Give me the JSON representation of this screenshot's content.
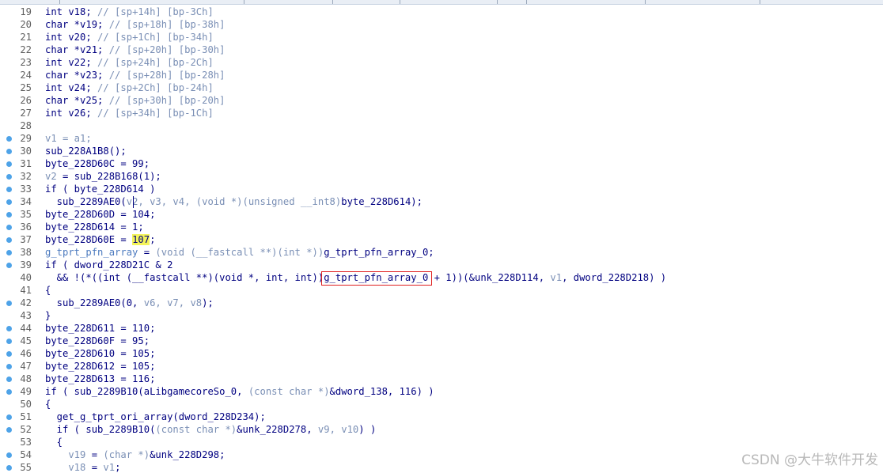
{
  "colors": {
    "background": "#ffffff",
    "line_number": "#606060",
    "code_default": "#000080",
    "comment": "#7a8fb5",
    "highlight": "#f4f45a",
    "annotation_box": "#e02020",
    "breakpoint_dot": "#4ea3e8"
  },
  "lines": [
    {
      "num": "19",
      "dot": false,
      "tokens": [
        {
          "t": "int v18; ",
          "c": "plain"
        },
        {
          "t": "// [sp+14h] [bp-3Ch]",
          "c": "comment"
        }
      ]
    },
    {
      "num": "20",
      "dot": false,
      "tokens": [
        {
          "t": "char *v19; ",
          "c": "plain"
        },
        {
          "t": "// [sp+18h] [bp-38h]",
          "c": "comment"
        }
      ]
    },
    {
      "num": "21",
      "dot": false,
      "tokens": [
        {
          "t": "int v20; ",
          "c": "plain"
        },
        {
          "t": "// [sp+1Ch] [bp-34h]",
          "c": "comment"
        }
      ]
    },
    {
      "num": "22",
      "dot": false,
      "tokens": [
        {
          "t": "char *v21; ",
          "c": "plain"
        },
        {
          "t": "// [sp+20h] [bp-30h]",
          "c": "comment"
        }
      ]
    },
    {
      "num": "23",
      "dot": false,
      "tokens": [
        {
          "t": "int v22; ",
          "c": "plain"
        },
        {
          "t": "// [sp+24h] [bp-2Ch]",
          "c": "comment"
        }
      ]
    },
    {
      "num": "24",
      "dot": false,
      "tokens": [
        {
          "t": "char *v23; ",
          "c": "plain"
        },
        {
          "t": "// [sp+28h] [bp-28h]",
          "c": "comment"
        }
      ]
    },
    {
      "num": "25",
      "dot": false,
      "tokens": [
        {
          "t": "int v24; ",
          "c": "plain"
        },
        {
          "t": "// [sp+2Ch] [bp-24h]",
          "c": "comment"
        }
      ]
    },
    {
      "num": "26",
      "dot": false,
      "tokens": [
        {
          "t": "char *v25; ",
          "c": "plain"
        },
        {
          "t": "// [sp+30h] [bp-20h]",
          "c": "comment"
        }
      ]
    },
    {
      "num": "27",
      "dot": false,
      "tokens": [
        {
          "t": "int v26; ",
          "c": "plain"
        },
        {
          "t": "// [sp+34h] [bp-1Ch]",
          "c": "comment"
        }
      ]
    },
    {
      "num": "28",
      "dot": false,
      "tokens": []
    },
    {
      "num": "29",
      "dot": true,
      "tokens": [
        {
          "t": "v1 = a1;",
          "c": "var"
        }
      ]
    },
    {
      "num": "30",
      "dot": true,
      "tokens": [
        {
          "t": "sub_228A1B8();",
          "c": "plain"
        }
      ]
    },
    {
      "num": "31",
      "dot": true,
      "tokens": [
        {
          "t": "byte_228D60C = 99;",
          "c": "plain"
        }
      ]
    },
    {
      "num": "32",
      "dot": true,
      "tokens": [
        {
          "t": "v2",
          "c": "var"
        },
        {
          "t": " = sub_228B168(1);",
          "c": "plain"
        }
      ]
    },
    {
      "num": "33",
      "dot": true,
      "tokens": [
        {
          "t": "if ( byte_228D614 )",
          "c": "plain"
        }
      ]
    },
    {
      "num": "34",
      "dot": true,
      "tokens": [
        {
          "t": "  sub_2289AE0(",
          "c": "plain"
        },
        {
          "t": "v2, v3, v4, ",
          "c": "var"
        },
        {
          "t": "(void *)",
          "c": "var"
        },
        {
          "t": "(unsigned __int8)",
          "c": "var"
        },
        {
          "t": "byte_228D614);",
          "c": "plain"
        }
      ]
    },
    {
      "num": "35",
      "dot": true,
      "tokens": [
        {
          "t": "byte_228D60D = 104;",
          "c": "plain"
        }
      ]
    },
    {
      "num": "36",
      "dot": true,
      "tokens": [
        {
          "t": "byte_228D614 = 1;",
          "c": "plain"
        }
      ]
    },
    {
      "num": "37",
      "dot": true,
      "tokens": [
        {
          "t": "byte_228D60E = ",
          "c": "plain"
        },
        {
          "t": "107",
          "c": "hl"
        },
        {
          "t": ";",
          "c": "plain"
        }
      ]
    },
    {
      "num": "38",
      "dot": true,
      "tokens": [
        {
          "t": "g_tprt_pfn_array",
          "c": "gvar"
        },
        {
          "t": " = ",
          "c": "plain"
        },
        {
          "t": "(void (__fastcall **)(int *))",
          "c": "var"
        },
        {
          "t": "g_tprt_pfn_array_0;",
          "c": "plain"
        }
      ]
    },
    {
      "num": "39",
      "dot": true,
      "tokens": [
        {
          "t": "if ( dword_228D21C & 2",
          "c": "plain"
        }
      ]
    },
    {
      "num": "40",
      "dot": false,
      "tokens": [
        {
          "t": "  && !(*((int (__fastcall **)(void *, int, int))",
          "c": "plain"
        },
        {
          "t": "g_tprt_pfn_array_0",
          "c": "plain"
        },
        {
          "t": " + 1))(&unk_228D114, ",
          "c": "plain"
        },
        {
          "t": "v1",
          "c": "var"
        },
        {
          "t": ", dword_228D218) )",
          "c": "plain"
        }
      ]
    },
    {
      "num": "41",
      "dot": false,
      "tokens": [
        {
          "t": "{",
          "c": "plain"
        }
      ]
    },
    {
      "num": "42",
      "dot": true,
      "tokens": [
        {
          "t": "  sub_2289AE0(0, ",
          "c": "plain"
        },
        {
          "t": "v6, v7, v8",
          "c": "var"
        },
        {
          "t": ");",
          "c": "plain"
        }
      ]
    },
    {
      "num": "43",
      "dot": false,
      "tokens": [
        {
          "t": "}",
          "c": "plain"
        }
      ]
    },
    {
      "num": "44",
      "dot": true,
      "tokens": [
        {
          "t": "byte_228D611 = 110;",
          "c": "plain"
        }
      ]
    },
    {
      "num": "45",
      "dot": true,
      "tokens": [
        {
          "t": "byte_228D60F = 95;",
          "c": "plain"
        }
      ]
    },
    {
      "num": "46",
      "dot": true,
      "tokens": [
        {
          "t": "byte_228D610 = 105;",
          "c": "plain"
        }
      ]
    },
    {
      "num": "47",
      "dot": true,
      "tokens": [
        {
          "t": "byte_228D612 = 105;",
          "c": "plain"
        }
      ]
    },
    {
      "num": "48",
      "dot": true,
      "tokens": [
        {
          "t": "byte_228D613 = 116;",
          "c": "plain"
        }
      ]
    },
    {
      "num": "49",
      "dot": true,
      "tokens": [
        {
          "t": "if ( sub_2289B10(aLibgamecoreSo_0, ",
          "c": "plain"
        },
        {
          "t": "(const char *)",
          "c": "var"
        },
        {
          "t": "&dword_138, 116) )",
          "c": "plain"
        }
      ]
    },
    {
      "num": "50",
      "dot": false,
      "tokens": [
        {
          "t": "{",
          "c": "plain"
        }
      ]
    },
    {
      "num": "51",
      "dot": true,
      "tokens": [
        {
          "t": "  get_g_tprt_ori_array(dword_228D234);",
          "c": "plain"
        }
      ]
    },
    {
      "num": "52",
      "dot": true,
      "tokens": [
        {
          "t": "  if ( sub_2289B10(",
          "c": "plain"
        },
        {
          "t": "(const char *)",
          "c": "var"
        },
        {
          "t": "&unk_228D278, ",
          "c": "plain"
        },
        {
          "t": "v9, v10",
          "c": "var"
        },
        {
          "t": ") )",
          "c": "plain"
        }
      ]
    },
    {
      "num": "53",
      "dot": false,
      "tokens": [
        {
          "t": "  {",
          "c": "plain"
        }
      ]
    },
    {
      "num": "54",
      "dot": true,
      "tokens": [
        {
          "t": "    v19",
          "c": "var"
        },
        {
          "t": " = ",
          "c": "plain"
        },
        {
          "t": "(char *)",
          "c": "var"
        },
        {
          "t": "&unk_228D298;",
          "c": "plain"
        }
      ]
    },
    {
      "num": "55",
      "dot": true,
      "tokens": [
        {
          "t": "    v18",
          "c": "var"
        },
        {
          "t": " = ",
          "c": "plain"
        },
        {
          "t": "v1",
          "c": "var"
        },
        {
          "t": ";",
          "c": "plain"
        }
      ]
    }
  ],
  "watermark": "CSDN @大牛软件开发"
}
